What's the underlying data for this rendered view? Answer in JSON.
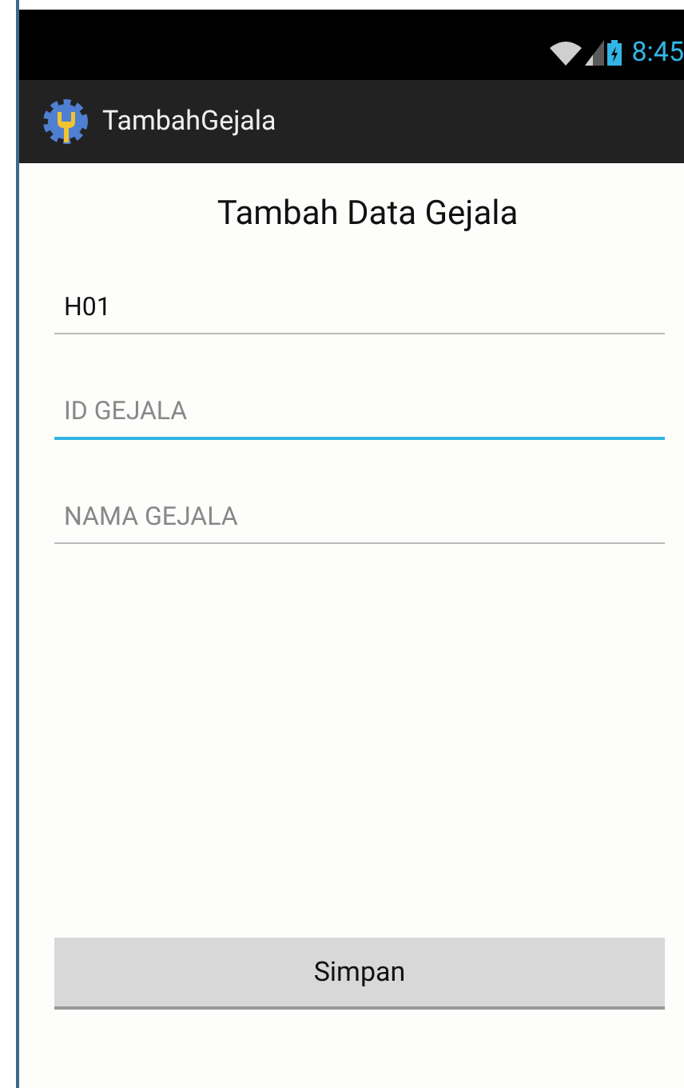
{
  "status_bar": {
    "time": "8:45"
  },
  "action_bar": {
    "title": "TambahGejala"
  },
  "heading": "Tambah Data Gejala",
  "fields": [
    {
      "value": "H01",
      "focused": false
    },
    {
      "placeholder": "ID GEJALA",
      "focused": true
    },
    {
      "placeholder": "NAMA GEJALA",
      "focused": false
    }
  ],
  "button": {
    "label": "Simpan"
  }
}
